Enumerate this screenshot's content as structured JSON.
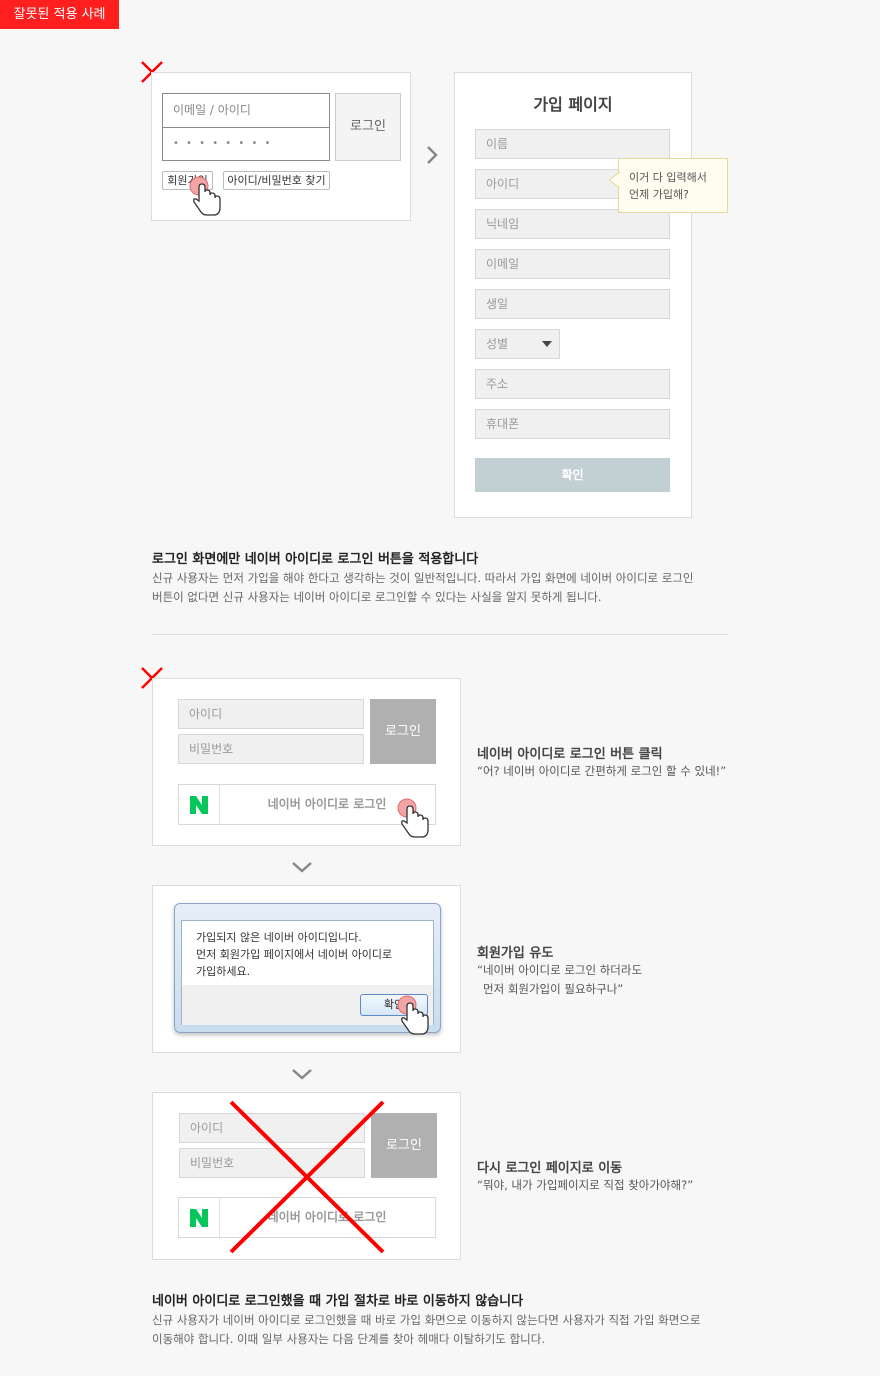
{
  "badge": "잘못된 적용 사례",
  "section1": {
    "login": {
      "id_placeholder": "이메일 / 아이디",
      "password_mask": "• • • • • • • •",
      "login_button": "로그인",
      "signup_link": "회원가입",
      "find_link": "아이디/비밀번호 찾기"
    },
    "signup": {
      "title": "가입 페이지",
      "fields": [
        "이름",
        "아이디",
        "닉네임",
        "이메일",
        "생일",
        "성별",
        "주소",
        "휴대폰"
      ],
      "tooltip_line1": "이거 다 입력해서",
      "tooltip_line2": "언제 가입해?",
      "confirm_button": "확인"
    },
    "heading": "로그인 화면에만 네이버 아이디로 로그인 버튼을 적용합니다",
    "desc_line1": "신규 사용자는 먼저 가입을 해야 한다고 생각하는 것이 일반적입니다. 따라서 가입 화면에 네이버 아이디로 로그인",
    "desc_line2": "버튼이 없다면 신규 사용자는 네이버 아이디로 로그인할 수 있다는 사실을 알지 못하게 됩니다."
  },
  "section2": {
    "step1": {
      "id_placeholder": "아이디",
      "pw_placeholder": "비밀번호",
      "login_button": "로그인",
      "naver_button": "네이버 아이디로 로그인",
      "title": "네이버 아이디로 로그인 버튼 클릭",
      "quote": "“어? 네이버 아이디로 간편하게 로그인 할 수 있네!”"
    },
    "step2": {
      "dialog_line1": "가입되지 않은 네이버 아이디입니다.",
      "dialog_line2": "먼저 회원가입 페이지에서 네이버 아이디로",
      "dialog_line3": "가입하세요.",
      "ok_button": "확인",
      "title": "회원가입 유도",
      "quote_line1": "“네이버 아이디로 로그인 하더라도",
      "quote_line2": "먼저 회원가입이 필요하구나”"
    },
    "step3": {
      "id_placeholder": "아이디",
      "pw_placeholder": "비밀번호",
      "login_button": "로그인",
      "naver_button": "네이버 아이디로 로그인",
      "title": "다시 로그인 페이지로 이동",
      "quote": "“뭐야, 내가 가입페이지로 직접 찾아가야해?”"
    },
    "heading": "네이버 아이디로 로그인했을 때 가입 절차로 바로 이동하지 않습니다",
    "desc_line1": "신규 사용자가 네이버 아이디로 로그인했을 때 바로 가입 화면으로 이동하지 않는다면 사용자가 직접 가입 화면으로",
    "desc_line2": "이동해야 합니다. 이때 일부 사용자는 다음 단계를 찾아 헤매다 이탈하기도 합니다."
  },
  "colors": {
    "badge": "#ff1f1f",
    "mark": "#ff0000",
    "naver_green": "#03c75a",
    "confirm_button": "#c2cfd3"
  },
  "icons": [
    "x-mark-icon",
    "chevron-right-icon",
    "chevron-down-icon",
    "hand-pointer-icon",
    "naver-n-icon",
    "dropdown-arrow-icon"
  ]
}
